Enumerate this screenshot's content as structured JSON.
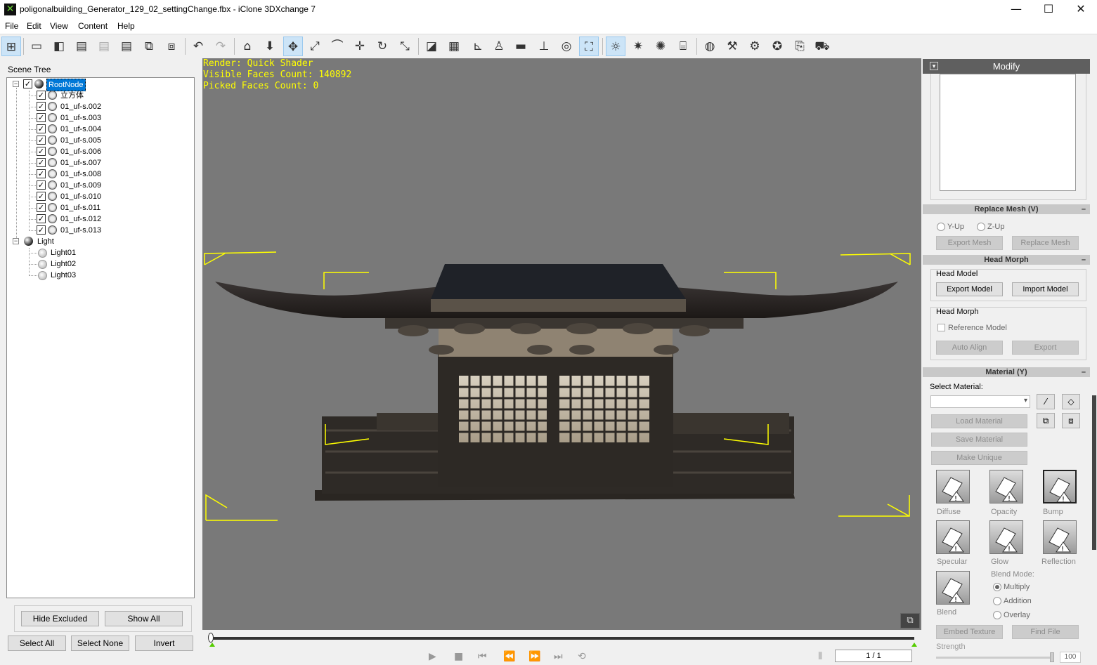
{
  "window": {
    "title": "poligonalbuilding_Generator_129_02_settingChange.fbx - iClone 3DXchange 7",
    "minimize": "—",
    "maximize": "☐",
    "close": "✕"
  },
  "menu": [
    "File",
    "Edit",
    "View",
    "Content",
    "Help"
  ],
  "toolbar": {
    "icons": [
      "scene-tree-icon",
      "open-folder-icon",
      "import-ic-icon",
      "import-fbx-icon",
      "import-bvh-icon",
      "import-obj-icon",
      "export-icon",
      "convert-icon",
      "undo-icon",
      "redo-icon",
      "home-icon",
      "drop-icon",
      "move-icon",
      "rotate-axis-icon",
      "bend-icon",
      "pan-icon",
      "rotate-icon",
      "scale-icon",
      "box-icon",
      "grid-icon",
      "axis-icon",
      "figure-icon",
      "plane-icon",
      "floor-icon",
      "globe-icon",
      "frame-icon",
      "light-icon",
      "sun-icon",
      "bright-icon",
      "building-icon",
      "sphere-icon",
      "wrench-icon",
      "morph-icon",
      "tools-icon",
      "export-ex-icon",
      "cart-icon"
    ]
  },
  "scene_tree": {
    "label": "Scene Tree",
    "root": "RootNode",
    "children": [
      "立方体",
      "01_uf-s.002",
      "01_uf-s.003",
      "01_uf-s.004",
      "01_uf-s.005",
      "01_uf-s.006",
      "01_uf-s.007",
      "01_uf-s.008",
      "01_uf-s.009",
      "01_uf-s.010",
      "01_uf-s.011",
      "01_uf-s.012",
      "01_uf-s.013"
    ],
    "light_group": "Light",
    "lights": [
      "Light01",
      "Light02",
      "Light03"
    ]
  },
  "scene_buttons": {
    "hide_excluded": "Hide Excluded",
    "show_all": "Show All",
    "select_all": "Select All",
    "select_none": "Select None",
    "invert": "Invert"
  },
  "viewport": {
    "render": "Render: Quick Shader",
    "visible_faces": "Visible Faces Count: 140892",
    "picked_faces": "Picked Faces Count: 0"
  },
  "timeline": {
    "start": "0",
    "frame": "1 / 1"
  },
  "modify": {
    "header": "Modify",
    "replace_mesh": {
      "title": "Replace Mesh (V)",
      "y_up": "Y-Up",
      "z_up": "Z-Up",
      "export_mesh": "Export Mesh",
      "replace_mesh": "Replace Mesh"
    },
    "head_morph": {
      "title": "Head Morph",
      "head_model": "Head Model",
      "export_model": "Export Model",
      "import_model": "Import Model",
      "head_morph": "Head Morph",
      "reference_model": "Reference Model",
      "auto_align": "Auto Align",
      "export": "Export"
    },
    "material": {
      "title": "Material (Y)",
      "select_material": "Select Material:",
      "load_material": "Load Material",
      "save_material": "Save Material",
      "make_unique": "Make Unique",
      "channels": [
        "Diffuse",
        "Opacity",
        "Bump",
        "Specular",
        "Glow",
        "Reflection",
        "Blend"
      ],
      "blend_mode": "Blend Mode:",
      "blend_options": [
        "Multiply",
        "Addition",
        "Overlay"
      ],
      "embed_texture": "Embed Texture",
      "find_file": "Find File",
      "strength": "Strength",
      "strength_value": "100"
    }
  },
  "minus": "–"
}
